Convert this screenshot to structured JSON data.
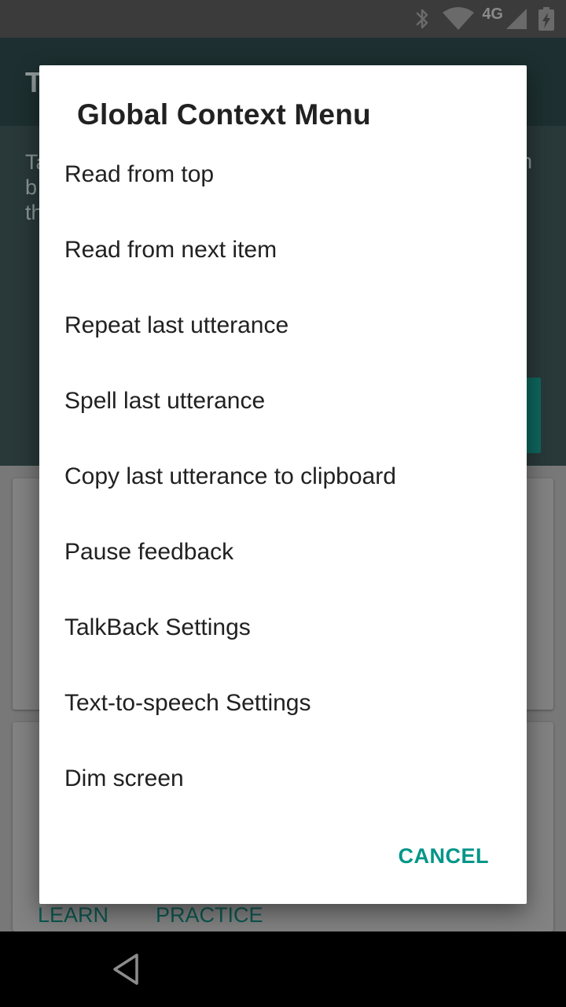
{
  "status_bar": {
    "network_type": "4G",
    "icons": [
      "bluetooth-icon",
      "wifi-icon",
      "cell-signal-icon",
      "battery-charging-icon"
    ]
  },
  "background_app": {
    "title": "T",
    "content_text_lines": [
      "Ta",
      "b",
      "th"
    ],
    "content_text_right": "n",
    "accent_color": "#009688",
    "card_actions": {
      "learn": "LEARN",
      "practice": "PRACTICE"
    }
  },
  "dialog": {
    "title": "Global Context Menu",
    "items": [
      "Read from top",
      "Read from next item",
      "Repeat last utterance",
      "Spell last utterance",
      "Copy last utterance to clipboard",
      "Pause feedback",
      "TalkBack Settings",
      "Text-to-speech Settings",
      "Dim screen"
    ],
    "cancel_label": "CANCEL"
  },
  "nav_bar": {
    "icons": [
      "back-icon"
    ]
  }
}
